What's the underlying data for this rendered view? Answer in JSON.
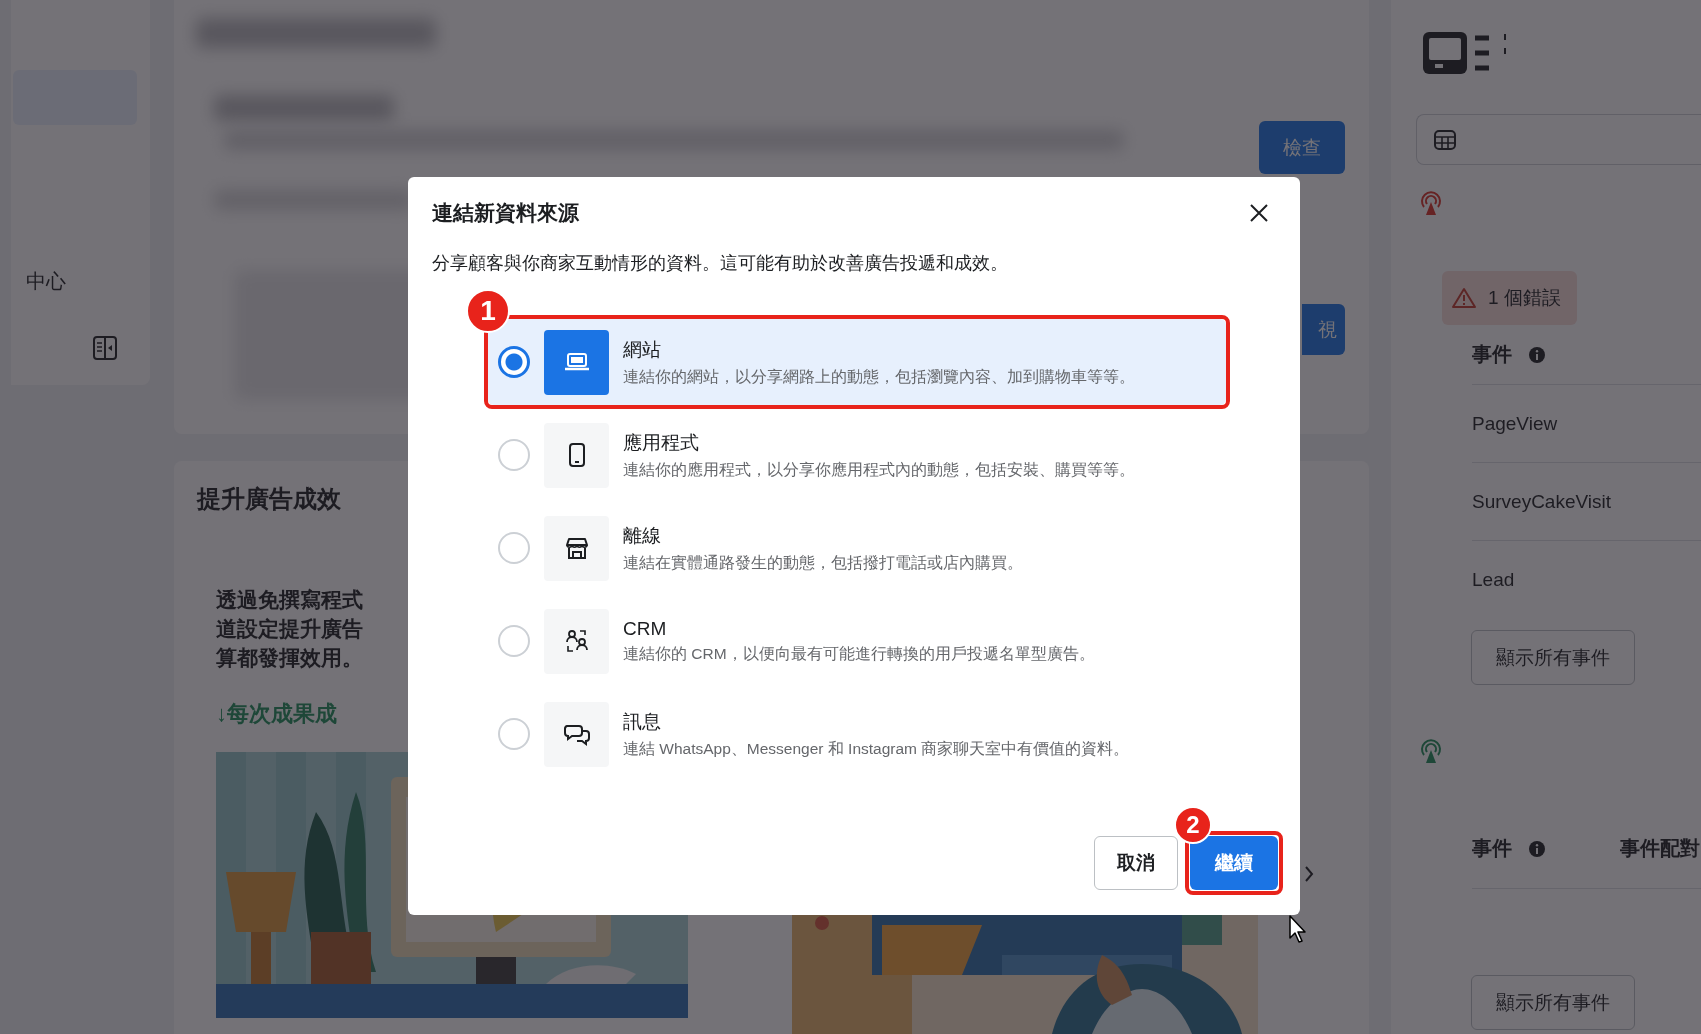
{
  "sidebar": {
    "label": "中心"
  },
  "main": {
    "check_button": "檢查",
    "view_button": "視",
    "section_title": "提升廣告成效",
    "promo_lines": [
      "透過免撰寫程式",
      "道設定提升廣告",
      "算都發揮效用。"
    ],
    "promo_link": "↓每次成果成"
  },
  "right_panel": {
    "groups": [
      {
        "kind": "error",
        "error_badge": "1 個錯誤",
        "columns": [
          {
            "label": "事件",
            "info": true
          }
        ],
        "events": [
          "PageView",
          "SurveyCakeVisit",
          "Lead"
        ],
        "button": "顯示所有事件"
      },
      {
        "kind": "ok",
        "columns": [
          {
            "label": "事件",
            "info": true
          },
          {
            "label": "事件配對",
            "info": false
          }
        ],
        "button": "顯示所有事件"
      }
    ]
  },
  "dialog": {
    "title": "連結新資料來源",
    "description": "分享顧客與你商家互動情形的資料。這可能有助於改善廣告投遞和成效。",
    "options": [
      {
        "kind": "website",
        "title": "網站",
        "description": "連結你的網站，以分享網路上的動態，包括瀏覽內容、加到購物車等等。",
        "selected": true,
        "annotation": "1"
      },
      {
        "kind": "app",
        "title": "應用程式",
        "description": "連結你的應用程式，以分享你應用程式內的動態，包括安裝、購買等等。",
        "selected": false
      },
      {
        "kind": "offline",
        "title": "離線",
        "description": "連結在實體通路發生的動態，包括撥打電話或店內購買。",
        "selected": false
      },
      {
        "kind": "crm",
        "title": "CRM",
        "description": "連結你的 CRM，以便向最有可能進行轉換的用戶投遞名單型廣告。",
        "selected": false
      },
      {
        "kind": "messaging",
        "title": "訊息",
        "description": "連結 WhatsApp、Messenger 和 Instagram 商家聊天室中有價值的資料。",
        "selected": false
      }
    ],
    "buttons": [
      {
        "label": "取消",
        "kind": "secondary"
      },
      {
        "label": "繼續",
        "kind": "primary",
        "annotation": "2"
      }
    ]
  }
}
